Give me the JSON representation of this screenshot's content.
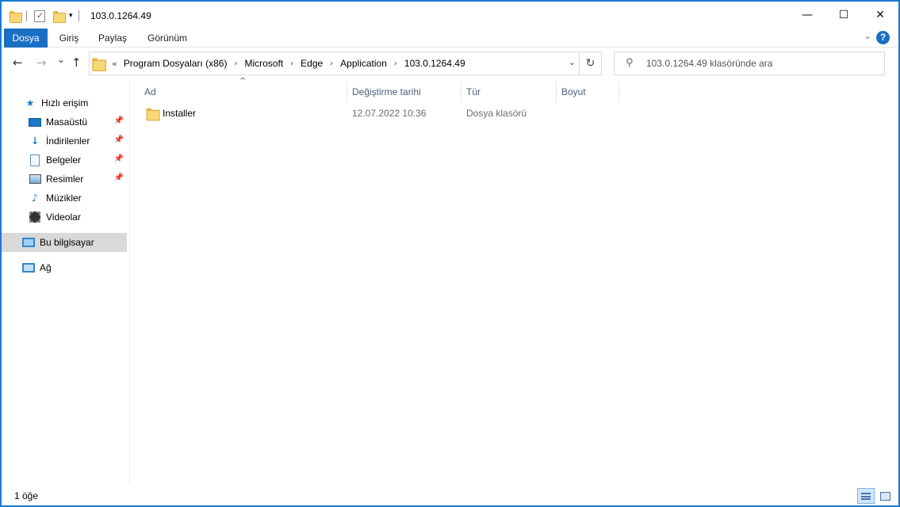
{
  "window": {
    "title": "103.0.1264.49",
    "controls": {
      "minimize": "—",
      "maximize": "☐",
      "close": "✕"
    }
  },
  "ribbon": {
    "tabs": [
      "Dosya",
      "Giriş",
      "Paylaş",
      "Görünüm"
    ],
    "help": "?"
  },
  "nav": {
    "back": "←",
    "forward": "→",
    "recent": "⌄",
    "up": "↑"
  },
  "address": {
    "lead": "«",
    "crumbs": [
      "Program Dosyaları (x86)",
      "Microsoft",
      "Edge",
      "Application",
      "103.0.1264.49"
    ],
    "separator": "›",
    "refresh": "↻"
  },
  "search": {
    "placeholder": "103.0.1264.49 klasöründe ara"
  },
  "navpane": {
    "quick_access": "Hızlı erişim",
    "items": [
      {
        "label": "Masaüstü",
        "icon": "desktop-icon",
        "pinned": true
      },
      {
        "label": "İndirilenler",
        "icon": "downloads-icon",
        "pinned": true
      },
      {
        "label": "Belgeler",
        "icon": "documents-icon",
        "pinned": true
      },
      {
        "label": "Resimler",
        "icon": "pictures-icon",
        "pinned": true
      },
      {
        "label": "Müzikler",
        "icon": "music-icon",
        "pinned": false
      },
      {
        "label": "Videolar",
        "icon": "videos-icon",
        "pinned": false
      }
    ],
    "this_pc": "Bu bilgisayar",
    "network": "Ağ"
  },
  "columns": {
    "name": "Ad",
    "date": "Değiştirme tarihi",
    "type": "Tür",
    "size": "Boyut"
  },
  "files": [
    {
      "name": "Installer",
      "date": "12.07.2022 10:36",
      "type": "Dosya klasörü",
      "size": ""
    }
  ],
  "status": {
    "count": "1 öğe"
  },
  "colors": {
    "accent": "#1a6fc4",
    "selected_nav": "#d9d9d9",
    "header_text": "#4c607a"
  }
}
